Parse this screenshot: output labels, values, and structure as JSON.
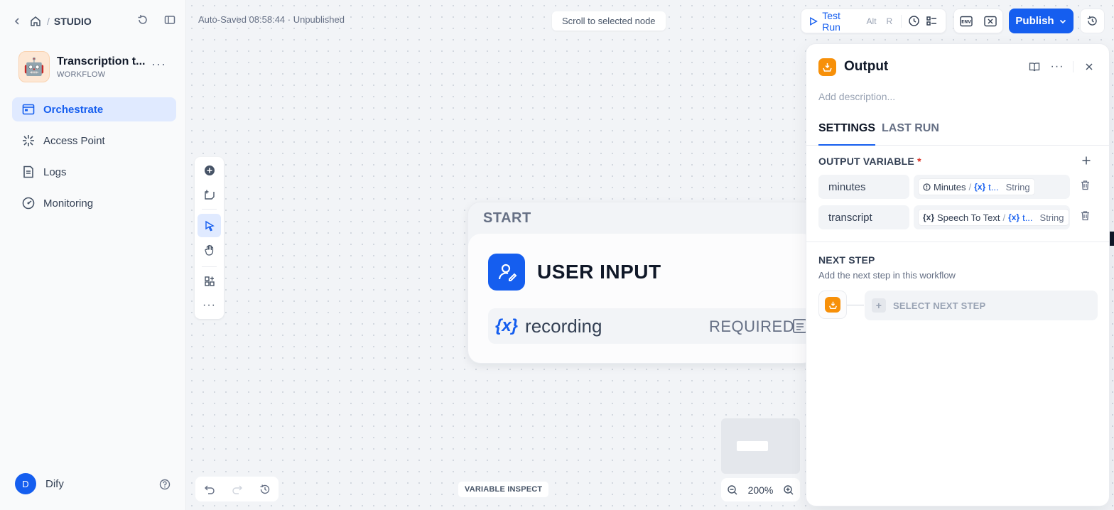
{
  "sidebar": {
    "breadcrumb": {
      "section": "STUDIO"
    },
    "app": {
      "name": "Transcription t...",
      "type": "WORKFLOW",
      "icon": "robot-icon"
    },
    "nav": [
      {
        "label": "Orchestrate",
        "icon": "orchestrate-icon",
        "active": true
      },
      {
        "label": "Access Point",
        "icon": "access-point-icon",
        "active": false
      },
      {
        "label": "Logs",
        "icon": "logs-icon",
        "active": false
      },
      {
        "label": "Monitoring",
        "icon": "monitoring-icon",
        "active": false
      }
    ],
    "user": {
      "initial": "D",
      "name": "Dify"
    }
  },
  "header": {
    "autosave": "Auto-Saved 08:58:44 · Unpublished",
    "scroll_button": "Scroll to selected node",
    "test_run": {
      "label": "Test Run",
      "shortcut": [
        "Alt",
        "R"
      ]
    },
    "publish": "Publish",
    "env_label": "ENV"
  },
  "canvas": {
    "start_node": {
      "header": "START",
      "title": "USER INPUT",
      "variable": {
        "symbol": "{x}",
        "name": "recording",
        "status": "REQUIRED"
      }
    },
    "zoom": "200%",
    "variable_inspect": "VARIABLE INSPECT"
  },
  "panel": {
    "title": "Output",
    "description_placeholder": "Add description...",
    "tabs": [
      {
        "label": "SETTINGS",
        "active": true
      },
      {
        "label": "LAST RUN",
        "active": false
      }
    ],
    "output_variable": {
      "title": "OUTPUT VARIABLE",
      "required_mark": "*",
      "rows": [
        {
          "name": "minutes",
          "source_node": "Minutes",
          "var_symbol": "{x}",
          "var": "t...",
          "type": "String"
        },
        {
          "name": "transcript",
          "source_node": "Speech To Text",
          "var_symbol": "{x}",
          "var": "t...",
          "type": "String"
        }
      ]
    },
    "next_step": {
      "title": "NEXT STEP",
      "subtitle": "Add the next step in this workflow",
      "select_label": "SELECT NEXT STEP"
    }
  },
  "colors": {
    "accent": "#155eef",
    "output_node": "#f79009",
    "active_nav_bg": "#e0eaff",
    "required": "#d92d20"
  }
}
